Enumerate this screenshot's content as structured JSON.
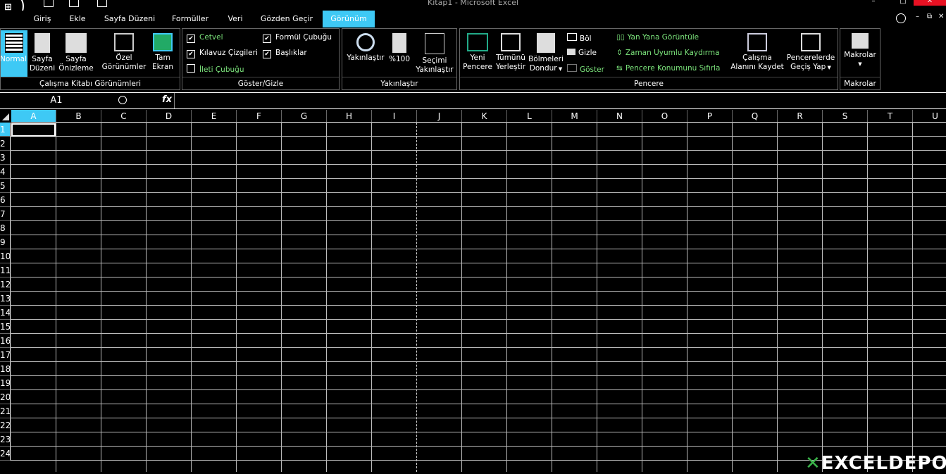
{
  "window": {
    "title": "Kitap1 - Microsoft Excel",
    "controls": [
      "–",
      "□",
      "✕"
    ]
  },
  "menu": {
    "tabs": [
      "Giriş",
      "Ekle",
      "Sayfa Düzeni",
      "Formüller",
      "Veri",
      "Gözden Geçir",
      "Görünüm"
    ],
    "active": "Görünüm"
  },
  "ribbon": {
    "workbook_views": {
      "label": "Çalışma Kitabı Görünümleri",
      "normal": "Normal",
      "page_layout": [
        "Sayfa",
        "Düzeni"
      ],
      "page_break": [
        "Sayfa",
        "Önizleme"
      ],
      "custom_views": [
        "Özel",
        "Görünümler"
      ],
      "full_screen": [
        "Tam",
        "Ekran"
      ]
    },
    "show_hide": {
      "label": "Göster/Gizle",
      "ruler": "Cetvel",
      "gridlines": "Kılavuz Çizgileri",
      "message_bar": "İleti Çubuğu",
      "formula_bar": "Formül Çubuğu",
      "headings": "Başlıklar",
      "checked": {
        "ruler": true,
        "gridlines": true,
        "message_bar": false,
        "formula_bar": true,
        "headings": true
      }
    },
    "zoom": {
      "label": "Yakınlaştır",
      "zoom": "Yakınlaştır",
      "hundred": "%100",
      "zoom_selection": [
        "Seçimi",
        "Yakınlaştır"
      ]
    },
    "window": {
      "label": "Pencere",
      "new_window": [
        "Yeni",
        "Pencere"
      ],
      "arrange_all": [
        "Tümünü",
        "Yerleştir"
      ],
      "freeze": [
        "Bölmeleri",
        "Dondur"
      ],
      "split": "Böl",
      "hide": "Gizle",
      "unhide": "Göster",
      "side_by_side": "Yan Yana Görüntüle",
      "sync_scroll": "Zaman Uyumlu Kaydırma",
      "reset_position": "Pencere Konumunu Sıfırla",
      "save_workspace": [
        "Çalışma",
        "Alanını Kaydet"
      ],
      "switch_windows": [
        "Pencerelerde",
        "Geçiş Yap"
      ]
    },
    "macros": {
      "label": "Makrolar",
      "macros": "Makrolar"
    }
  },
  "formula_bar": {
    "name_box": "A1",
    "fx": "fx",
    "value": ""
  },
  "sheet": {
    "columns": [
      "A",
      "B",
      "C",
      "D",
      "E",
      "F",
      "G",
      "H",
      "I",
      "J",
      "K",
      "L",
      "M",
      "N",
      "O",
      "P",
      "Q",
      "R",
      "S",
      "T",
      "U"
    ],
    "rows": [
      "1",
      "2",
      "3",
      "4",
      "5",
      "6",
      "7",
      "8",
      "9",
      "10",
      "11",
      "12",
      "13",
      "14",
      "15",
      "16",
      "17",
      "18",
      "19",
      "20",
      "21",
      "22",
      "23",
      "24"
    ],
    "active_cell": "A1"
  },
  "watermark": "EXCELDEPO"
}
